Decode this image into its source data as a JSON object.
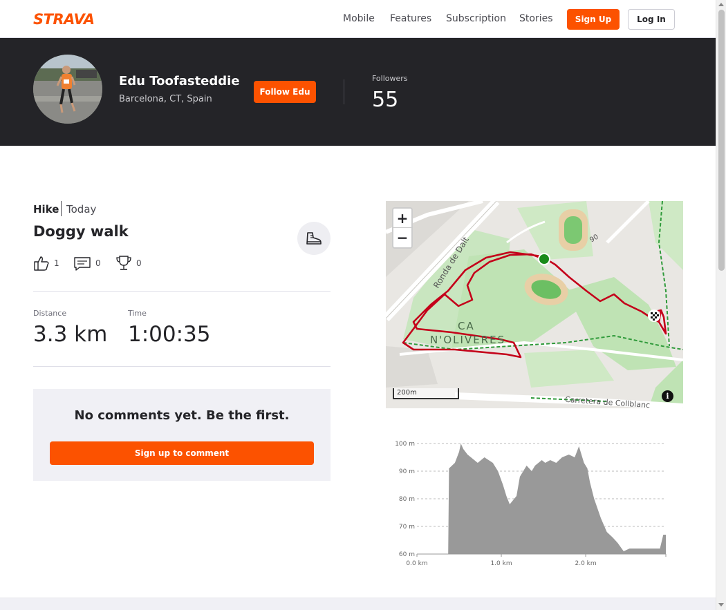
{
  "nav": {
    "logo": "STRAVA",
    "links": [
      "Mobile",
      "Features",
      "Subscription",
      "Stories"
    ],
    "signup": "Sign Up",
    "login": "Log In"
  },
  "athlete": {
    "name": "Edu Toofasteddie",
    "location": "Barcelona, CT, Spain",
    "follow_label": "Follow Edu",
    "followers_label": "Followers",
    "followers_count": "55"
  },
  "activity": {
    "type": "Hike",
    "date": "Today",
    "title": "Doggy walk",
    "sport_icon": "hiking-boot-icon",
    "kudos": "1",
    "comments": "0",
    "achievements": "0",
    "distance_label": "Distance",
    "distance_value": "3.3 km",
    "time_label": "Time",
    "time_value": "1:00:35"
  },
  "comments": {
    "empty_text": "No comments yet. Be the first.",
    "signup_label": "Sign up to comment"
  },
  "map": {
    "zoom_in": "+",
    "zoom_out": "−",
    "scale": "200m",
    "info": "i",
    "labels": {
      "road1": "Ronda de Dalt",
      "area1": "CA",
      "area2": "N'OLIVERES",
      "road2": "Carretera de Collblanc",
      "num": "90"
    },
    "route_color": "#c4001a",
    "start_color": "#1a8a1a"
  },
  "chart_data": {
    "type": "area",
    "title": "",
    "xlabel": "",
    "ylabel": "",
    "ylim": [
      60,
      100
    ],
    "xlim": [
      0,
      2.95
    ],
    "yticks": [
      "60 m",
      "70 m",
      "80 m",
      "90 m",
      "100 m"
    ],
    "xticks": [
      "0.0 km",
      "1.0 km",
      "2.0 km"
    ],
    "grid": true,
    "fill_color": "#999999",
    "x": [
      0.37,
      0.38,
      0.45,
      0.5,
      0.52,
      0.55,
      0.6,
      0.68,
      0.72,
      0.8,
      0.85,
      0.9,
      0.96,
      1.02,
      1.06,
      1.1,
      1.18,
      1.22,
      1.3,
      1.36,
      1.4,
      1.48,
      1.52,
      1.58,
      1.65,
      1.72,
      1.8,
      1.87,
      1.92,
      1.98,
      2.02,
      2.05,
      2.1,
      2.18,
      2.25,
      2.32,
      2.38,
      2.45,
      2.52,
      2.6,
      2.7,
      2.78,
      2.84,
      2.88,
      2.92,
      2.95
    ],
    "y": [
      60,
      91,
      93,
      97,
      100,
      98,
      96,
      94,
      93,
      95,
      94,
      93,
      90,
      85,
      81,
      78,
      81,
      88,
      92,
      90,
      92,
      94,
      93,
      94,
      93,
      95,
      96,
      95,
      99,
      93,
      91,
      86,
      80,
      73,
      68,
      66,
      64,
      61,
      62,
      62,
      62,
      62,
      62,
      62,
      67,
      67
    ]
  }
}
